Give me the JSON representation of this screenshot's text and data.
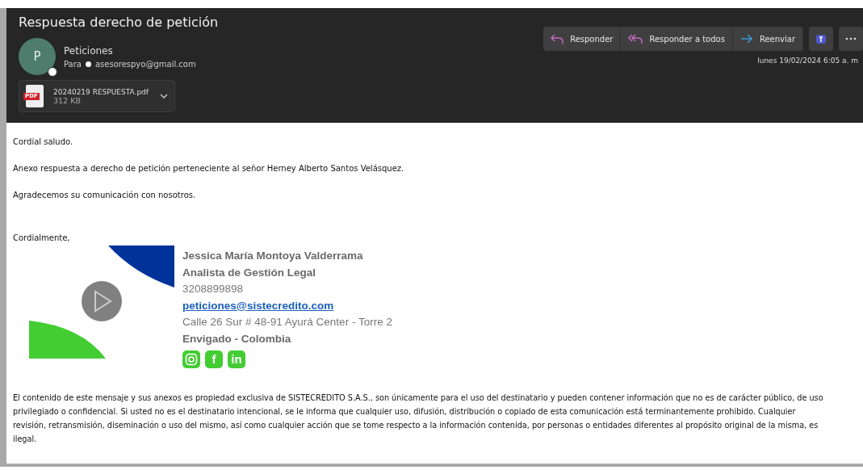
{
  "email": {
    "subject": "Respuesta derecho de petición",
    "sender": {
      "initial": "P",
      "name": "Peticiones",
      "to_label": "Para",
      "recipient": "asesorespyo@gmail.com"
    },
    "attachment": {
      "filename": "20240219 RESPUESTA.pdf",
      "size": "312 KB",
      "type_label": "PDF"
    },
    "actions": [
      {
        "kind": "reply",
        "label": "Responder"
      },
      {
        "kind": "reply_all",
        "label": "Responder a todos"
      },
      {
        "kind": "forward",
        "label": "Reenviar"
      }
    ],
    "date": "lunes 19/02/2024 6:05 a. m",
    "body": [
      "Cordial saludo.",
      "Anexo respuesta a derecho de petición perteneciente al señor Herney Alberto Santos Velásquez.",
      "Agradecemos su comunicación con nosotros."
    ],
    "closing": "Cordialmente,",
    "signature": {
      "name": "Jessica María Montoya Valderrama",
      "role": "Analista de Gestión Legal",
      "phone": "3208899898",
      "email": "peticiones@sistecredito.com",
      "address": "Calle 26 Sur # 48-91 Ayurá Center - Torre 2",
      "city": "Envigado - Colombia",
      "social": [
        {
          "kind": "instagram"
        },
        {
          "kind": "facebook",
          "label": "f"
        },
        {
          "kind": "linkedin",
          "label": "in"
        }
      ]
    },
    "disclaimer": [
      "El contenido de este mensaje y sus anexos es propiedad exclusiva de SISTECREDITO S.A.S., son únicamente para el uso del destinatario y pueden contener información que no es de carácter público, de uso",
      "privilegiado o confidencial. Si usted no es el destinatario intencional, se le informa que cualquier uso, difusión, distribución o copiado de esta comunicación está terminantemente prohibido. Cualquier",
      "revisión, retransmisión, diseminación o uso del mismo, así como cualquier acción que se tome respecto a la información contenida, por personas o entidades diferentes al propósito original de la misma, es",
      "ilegal."
    ]
  }
}
